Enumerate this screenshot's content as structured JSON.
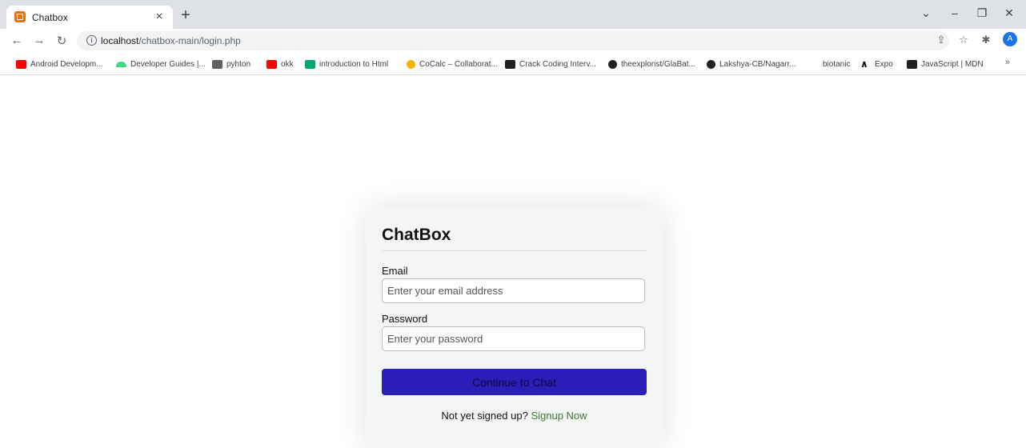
{
  "browser": {
    "tab_title": "Chatbox",
    "tab_close": "×",
    "new_tab": "+",
    "url_host": "localhost",
    "url_path": "/chatbox-main/login.php",
    "profile_initial": "A",
    "window_controls": {
      "dropdown": "⌄",
      "minimize": "–",
      "restore": "❐",
      "close": "✕"
    },
    "bookmarks": [
      {
        "label": "Android Developm...",
        "icon": "youtube-icon",
        "color": "#ff0000"
      },
      {
        "label": "Developer Guides |...",
        "icon": "android-icon",
        "color": "#3ddc84"
      },
      {
        "label": "pyhton",
        "icon": "grid-icon",
        "color": "#5f6368"
      },
      {
        "label": "okk",
        "icon": "youtube-icon",
        "color": "#ff0000"
      },
      {
        "label": "introduction to Html",
        "icon": "w3-icon",
        "color": "#04aa6d"
      },
      {
        "label": "CoCalc – Collaborat...",
        "icon": "cocalc-icon",
        "color": "#f4b400"
      },
      {
        "label": "Crack Coding Interv...",
        "icon": "video-icon",
        "color": "#202124"
      },
      {
        "label": "theexplorist/GlaBat...",
        "icon": "github-icon",
        "color": "#202124"
      },
      {
        "label": "Lakshya-CB/Nagarr...",
        "icon": "github-icon",
        "color": "#202124"
      },
      {
        "label": "biotanic",
        "icon": "none",
        "color": "#ffffff"
      },
      {
        "label": "Expo",
        "icon": "expo-icon",
        "color": "#000000"
      },
      {
        "label": "JavaScript | MDN",
        "icon": "mdn-icon",
        "color": "#202124"
      }
    ],
    "more_bookmarks": "»"
  },
  "login": {
    "title": "ChatBox",
    "email_label": "Email",
    "email_placeholder": "Enter your email address",
    "password_label": "Password",
    "password_placeholder": "Enter your password",
    "submit_label": "Continue to Chat",
    "signup_prompt": "Not yet signed up?",
    "signup_link": "Signup Now"
  },
  "colors": {
    "button_bg": "#2a1db8",
    "link": "#3a7a30"
  }
}
